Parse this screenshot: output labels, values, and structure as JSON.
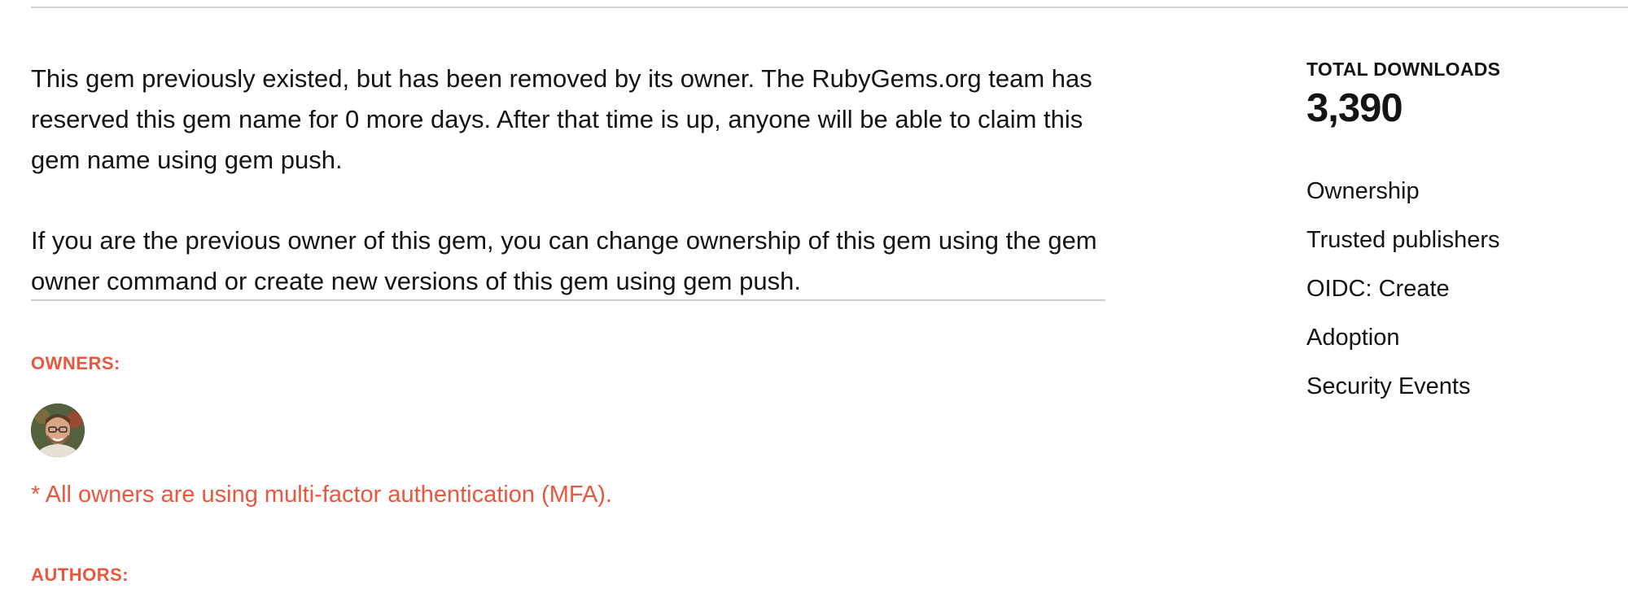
{
  "main": {
    "notice": "This gem previously existed, but has been removed by its owner. The RubyGems.org team has reserved this gem name for 0 more days. After that time is up, anyone will be able to claim this gem name using gem push.",
    "owner_help": "If you are the previous owner of this gem, you can change ownership of this gem using the gem owner command or create new versions of this gem using gem push.",
    "owners_label": "OWNERS:",
    "mfa_note": "* All owners are using multi-factor authentication (MFA).",
    "authors_label": "AUTHORS:"
  },
  "sidebar": {
    "downloads_label": "TOTAL DOWNLOADS",
    "downloads_count": "3,390",
    "links": [
      "Ownership",
      "Trusted publishers",
      "OIDC: Create",
      "Adoption",
      "Security Events"
    ]
  },
  "colors": {
    "accent": "#e9573f",
    "text": "#141414",
    "rule": "#d4d4d4"
  }
}
